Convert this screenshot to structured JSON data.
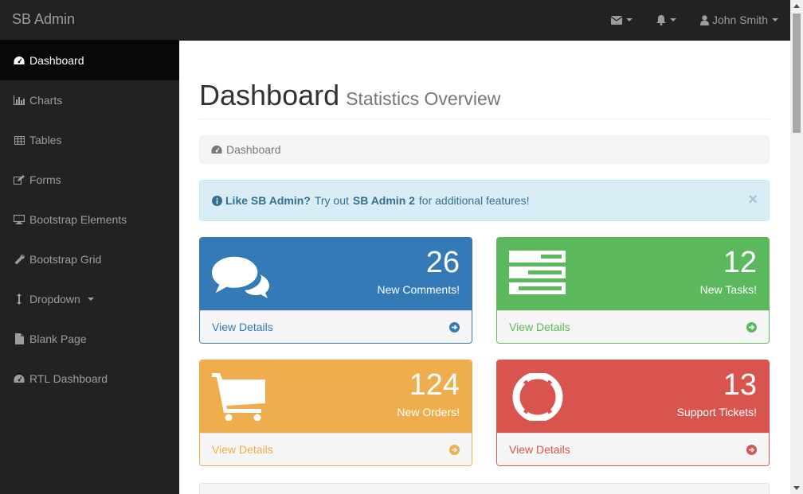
{
  "brand": "SB Admin",
  "topnav": {
    "user_name": "John Smith"
  },
  "sidebar": {
    "items": [
      {
        "label": "Dashboard",
        "icon": "dashboard-icon"
      },
      {
        "label": "Charts",
        "icon": "bar-chart-icon"
      },
      {
        "label": "Tables",
        "icon": "table-icon"
      },
      {
        "label": "Forms",
        "icon": "edit-icon"
      },
      {
        "label": "Bootstrap Elements",
        "icon": "desktop-icon"
      },
      {
        "label": "Bootstrap Grid",
        "icon": "wrench-icon"
      },
      {
        "label": "Dropdown",
        "icon": "arrows-v-icon"
      },
      {
        "label": "Blank Page",
        "icon": "file-icon"
      },
      {
        "label": "RTL Dashboard",
        "icon": "dashboard-icon"
      }
    ]
  },
  "header": {
    "title": "Dashboard",
    "subtitle": "Statistics Overview"
  },
  "breadcrumb": {
    "label": "Dashboard"
  },
  "alert": {
    "lead": "Like SB Admin?",
    "text1": "Try out",
    "link": "SB Admin 2",
    "text2": "for additional features!",
    "close": "×"
  },
  "panels": [
    {
      "value": "26",
      "label": "New Comments!",
      "footer": "View Details",
      "color": "#337ab7",
      "icon": "comments-icon"
    },
    {
      "value": "12",
      "label": "New Tasks!",
      "footer": "View Details",
      "color": "#5cb85c",
      "icon": "tasks-icon"
    },
    {
      "value": "124",
      "label": "New Orders!",
      "footer": "View Details",
      "color": "#f0ad4e",
      "icon": "shopping-cart-icon"
    },
    {
      "value": "13",
      "label": "Support Tickets!",
      "footer": "View Details",
      "color": "#d9534f",
      "icon": "support-icon"
    }
  ]
}
